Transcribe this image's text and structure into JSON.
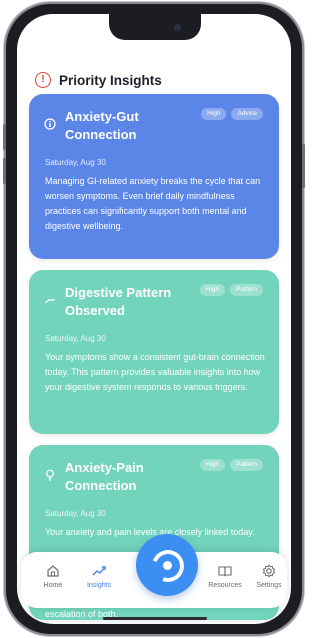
{
  "header": {
    "title": "Priority Insights"
  },
  "cards": [
    {
      "title": "Anxiety-Gut Connection",
      "badges": [
        "High",
        "Advice"
      ],
      "date": "Saturday, Aug 30",
      "body": "Managing GI-related anxiety breaks the cycle that can worsen symptoms. Even brief daily mindfulness practices can significantly support both mental and digestive wellbeing.",
      "color": "#5b86e8",
      "icon": "info-icon"
    },
    {
      "title": "Digestive Pattern Observed",
      "badges": [
        "High",
        "Pattern"
      ],
      "date": "Saturday, Aug 30",
      "body": "Your symptoms show a consistent gut-brain connection today. This pattern provides valuable insights into how your digestive system responds to various triggers.",
      "color": "#72d4bb",
      "icon": "trend-icon"
    },
    {
      "title": "Anxiety-Pain Connection",
      "badges": [
        "High",
        "Pattern"
      ],
      "date": "Saturday, Aug 30",
      "body": "Your anxiety and pain levels are closely linked today.",
      "color": "#72d4bb",
      "icon": "lightbulb-icon"
    }
  ],
  "overflow_text": "escalation of both.",
  "nav": {
    "items": [
      {
        "label": "Home",
        "icon": "home-icon"
      },
      {
        "label": "Insights",
        "icon": "trend-icon"
      },
      {
        "label": "Resources",
        "icon": "book-icon"
      },
      {
        "label": "Settings",
        "icon": "gear-icon"
      }
    ],
    "active_color": "#4a80e6"
  }
}
